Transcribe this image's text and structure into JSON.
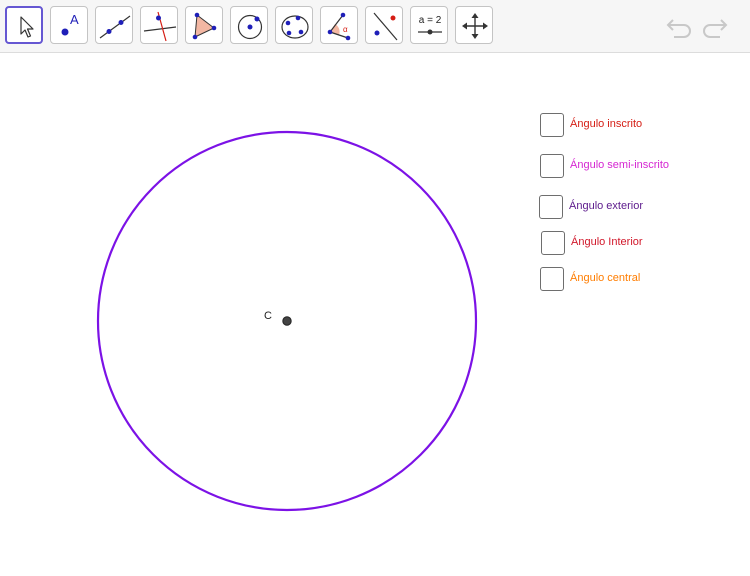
{
  "toolbar": {
    "tools": [
      {
        "name": "move-tool",
        "icon": "cursor-arrow-icon",
        "active": true
      },
      {
        "name": "point-tool",
        "icon": "point-icon",
        "label": "A"
      },
      {
        "name": "line-tool",
        "icon": "line-through-points-icon"
      },
      {
        "name": "perpendicular-line-tool",
        "icon": "perpendicular-line-icon"
      },
      {
        "name": "polygon-tool",
        "icon": "polygon-icon"
      },
      {
        "name": "circle-center-point-tool",
        "icon": "circle-center-point-icon"
      },
      {
        "name": "conic-five-points-tool",
        "icon": "conic-icon"
      },
      {
        "name": "angle-tool",
        "icon": "angle-icon",
        "label": "α"
      },
      {
        "name": "reflect-about-line-tool",
        "icon": "reflect-icon"
      },
      {
        "name": "slider-tool",
        "icon": "slider-icon",
        "label": "a = 2"
      },
      {
        "name": "move-graphics-view-tool",
        "icon": "move-graphics-view-icon"
      }
    ],
    "undo": {
      "icon": "undo-icon"
    },
    "redo": {
      "icon": "redo-icon"
    }
  },
  "graphics": {
    "circle_color": "#7c12e6",
    "center_point": {
      "label": "C"
    }
  },
  "checkboxes": [
    {
      "label": "Ángulo inscrito",
      "color": "#d51d14",
      "checked": false
    },
    {
      "label": "Ángulo semi-inscrito",
      "color": "#d526d2",
      "checked": false
    },
    {
      "label": "Ángulo exterior",
      "color": "#5c1a8c",
      "checked": false
    },
    {
      "label": "Ángulo Interior",
      "color": "#d1172a",
      "checked": false
    },
    {
      "label": "Ángulo central",
      "color": "#ff7d00",
      "checked": false
    }
  ]
}
